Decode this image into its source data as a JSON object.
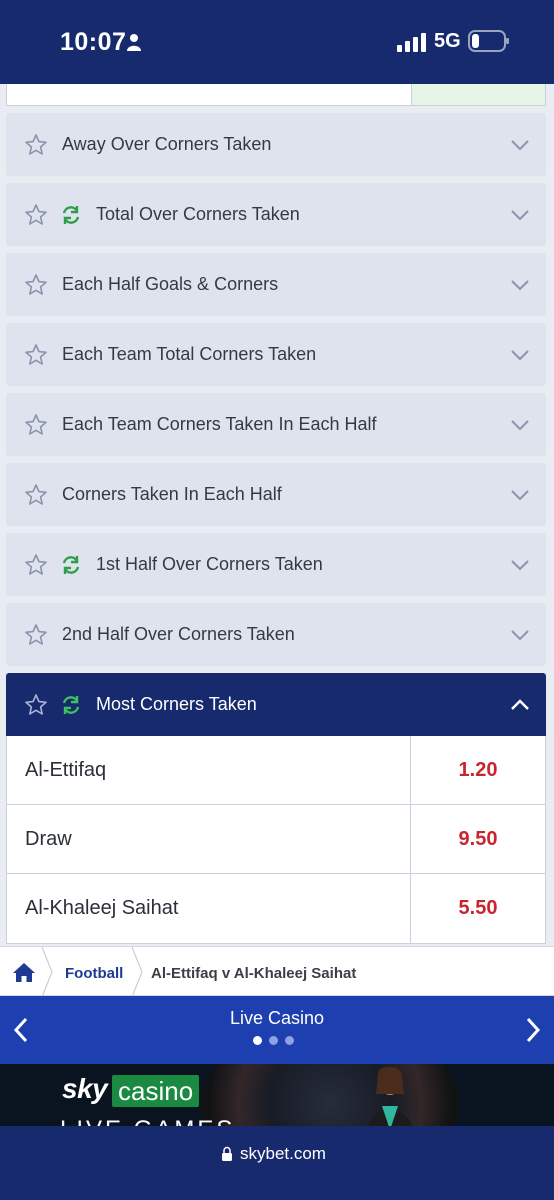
{
  "status_bar": {
    "time": "10:07",
    "network": "5G",
    "icons": [
      "person-icon",
      "signal-icon",
      "battery-icon"
    ]
  },
  "markets": [
    {
      "label": "Away Over Corners Taken",
      "cashout": false
    },
    {
      "label": "Total Over Corners Taken",
      "cashout": true
    },
    {
      "label": "Each Half Goals & Corners",
      "cashout": false
    },
    {
      "label": "Each Team Total Corners Taken",
      "cashout": false
    },
    {
      "label": "Each Team Corners Taken In Each Half",
      "cashout": false
    },
    {
      "label": "Corners Taken In Each Half",
      "cashout": false
    },
    {
      "label": "1st Half Over Corners Taken",
      "cashout": true
    },
    {
      "label": "2nd Half Over Corners Taken",
      "cashout": false
    }
  ],
  "open_market": {
    "label": "Most Corners Taken",
    "cashout": true,
    "selections": [
      {
        "name": "Al-Ettifaq",
        "odds": "1.20"
      },
      {
        "name": "Draw",
        "odds": "9.50"
      },
      {
        "name": "Al-Khaleej Saihat",
        "odds": "5.50"
      }
    ]
  },
  "breadcrumb": {
    "items": [
      "Football",
      "Al-Ettifaq v Al-Khaleej Saihat"
    ]
  },
  "promo": {
    "title": "Live Casino",
    "slide_count": 3,
    "active_slide": 1
  },
  "casino_ad": {
    "brand_sky": "sky",
    "brand_casino": "casino",
    "tagline": "LIVE GAMES"
  },
  "url_bar": {
    "url": "skybet.com"
  },
  "colors": {
    "navy": "#172a6e",
    "market_bg": "#dfe3ee",
    "odds_red": "#c8262f",
    "cashout_green": "#2e9e4a",
    "promo_blue": "#1d3fb0"
  }
}
